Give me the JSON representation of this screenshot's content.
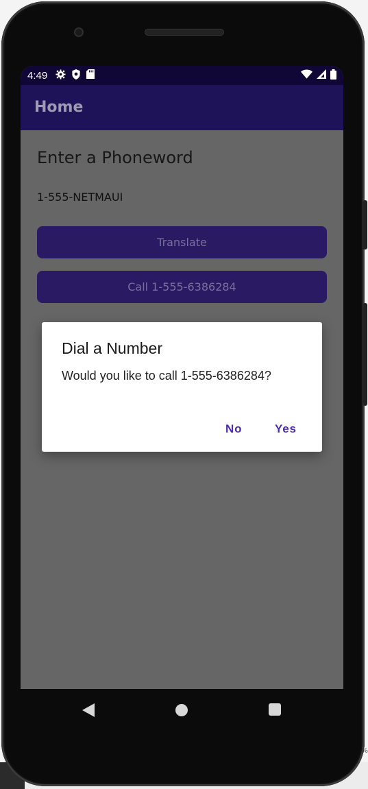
{
  "status_bar": {
    "time": "4:49",
    "left_icons": [
      "gear-icon",
      "shield-icon",
      "sd-card-icon"
    ],
    "right_icons": [
      "wifi-icon",
      "cell-signal-icon",
      "battery-icon"
    ]
  },
  "app_bar": {
    "title": "Home"
  },
  "main": {
    "heading": "Enter a Phoneword",
    "phoneword_value": "1-555-NETMAUI",
    "translate_label": "Translate",
    "call_label": "Call 1-555-6386284"
  },
  "dialog": {
    "title": "Dial a Number",
    "message": "Would you like to call 1-555-6386284?",
    "no_label": "No",
    "yes_label": "Yes"
  },
  "nav_bar": {
    "icons": [
      "back-icon",
      "home-icon",
      "recents-icon"
    ]
  },
  "edge_label": "%",
  "colors": {
    "status_bar": "#110736",
    "app_bar": "#1e1258",
    "button": "#2a1a63",
    "dialog_action": "#4d2bb8",
    "scrim": "#666666"
  }
}
